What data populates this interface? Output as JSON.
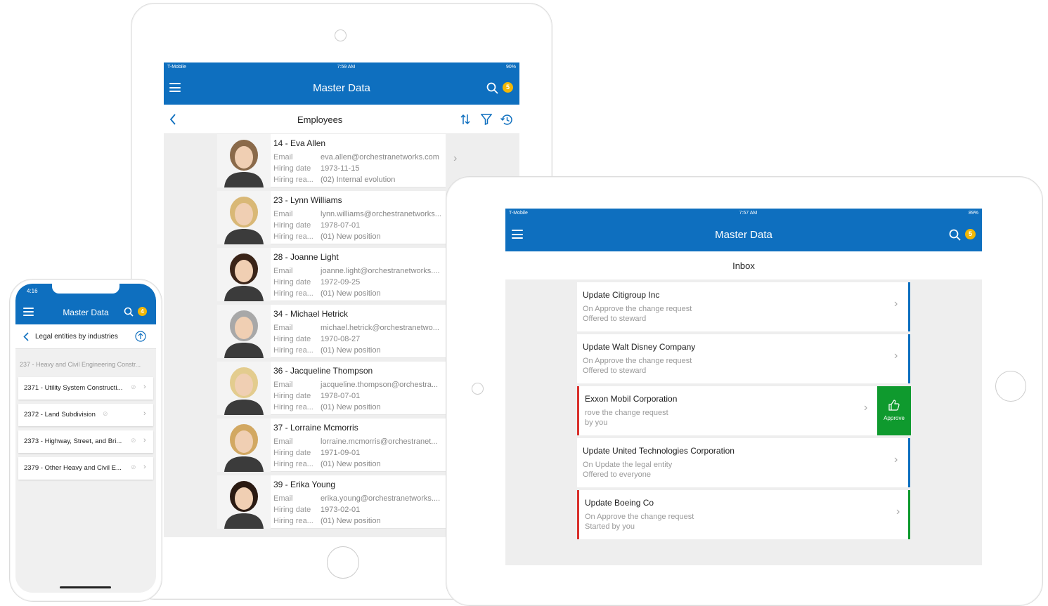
{
  "back_tablet": {
    "status": {
      "carrier": "T-Mobile",
      "time": "7:59 AM",
      "battery": "90%"
    },
    "header": {
      "title": "Master Data",
      "badge": "5"
    },
    "subheader": {
      "title": "Employees"
    },
    "labels": {
      "email": "Email",
      "hiring_date": "Hiring date",
      "hiring_reason": "Hiring rea..."
    },
    "employees": [
      {
        "name": "14 - Eva Allen",
        "email": "eva.allen@orchestranetworks.com",
        "date": "1973-11-15",
        "reason": "(02) Internal evolution",
        "hair": "#8a6a4a"
      },
      {
        "name": "23 - Lynn Williams",
        "email": "lynn.williams@orchestranetworks...",
        "date": "1978-07-01",
        "reason": "(01) New position",
        "hair": "#d9b876"
      },
      {
        "name": "28 - Joanne Light",
        "email": "joanne.light@orchestranetworks....",
        "date": "1972-09-25",
        "reason": "(01) New position",
        "hair": "#3a2418"
      },
      {
        "name": "34 - Michael Hetrick",
        "email": "michael.hetrick@orchestranetwo...",
        "date": "1970-08-27",
        "reason": "(01) New position",
        "hair": "#a8a8a8"
      },
      {
        "name": "36 - Jacqueline Thompson",
        "email": "jacqueline.thompson@orchestra...",
        "date": "1978-07-01",
        "reason": "(01) New position",
        "hair": "#e3cc8e"
      },
      {
        "name": "37 - Lorraine Mcmorris",
        "email": "lorraine.mcmorris@orchestranet...",
        "date": "1971-09-01",
        "reason": "(01) New position",
        "hair": "#d2a862"
      },
      {
        "name": "39 - Erika Young",
        "email": "erika.young@orchestranetworks....",
        "date": "1973-02-01",
        "reason": "(01) New position",
        "hair": "#2a1a12"
      }
    ]
  },
  "front_tablet": {
    "status": {
      "carrier": "T-Mobile",
      "time": "7:57 AM",
      "battery": "89%"
    },
    "header": {
      "title": "Master Data",
      "badge": "5"
    },
    "subheader": {
      "title": "Inbox"
    },
    "approve_label": "Approve",
    "tasks": [
      {
        "title": "Update Citigroup Inc",
        "line1": "On Approve the change request",
        "line2": "Offered to steward"
      },
      {
        "title": "Update Walt Disney Company",
        "line1": "On Approve the change request",
        "line2": "Offered to steward"
      },
      {
        "title": "Exxon Mobil Corporation",
        "line1": "rove the change request",
        "line2": "by you"
      },
      {
        "title": "Update United Technologies Corporation",
        "line1": "On Update the legal entity",
        "line2": "Offered to everyone"
      },
      {
        "title": "Update Boeing Co",
        "line1": "On Approve the change request",
        "line2": "Started by you"
      }
    ]
  },
  "phone": {
    "status": {
      "time": "4:16"
    },
    "header": {
      "title": "Master Data",
      "badge": "4"
    },
    "subheader": {
      "title": "Legal entities by industries"
    },
    "section": "237 - Heavy and Civil Engineering Constr...",
    "items": [
      {
        "label": "2371 - Utility System Constructi..."
      },
      {
        "label": "2372 - Land Subdivision"
      },
      {
        "label": "2373 - Highway, Street, and Bri..."
      },
      {
        "label": "2379 - Other Heavy and Civil E..."
      }
    ]
  },
  "colors": {
    "brand": "#0e6fbf",
    "badge": "#f2b705",
    "approve": "#0f9a2e",
    "alert": "#d9302b"
  }
}
